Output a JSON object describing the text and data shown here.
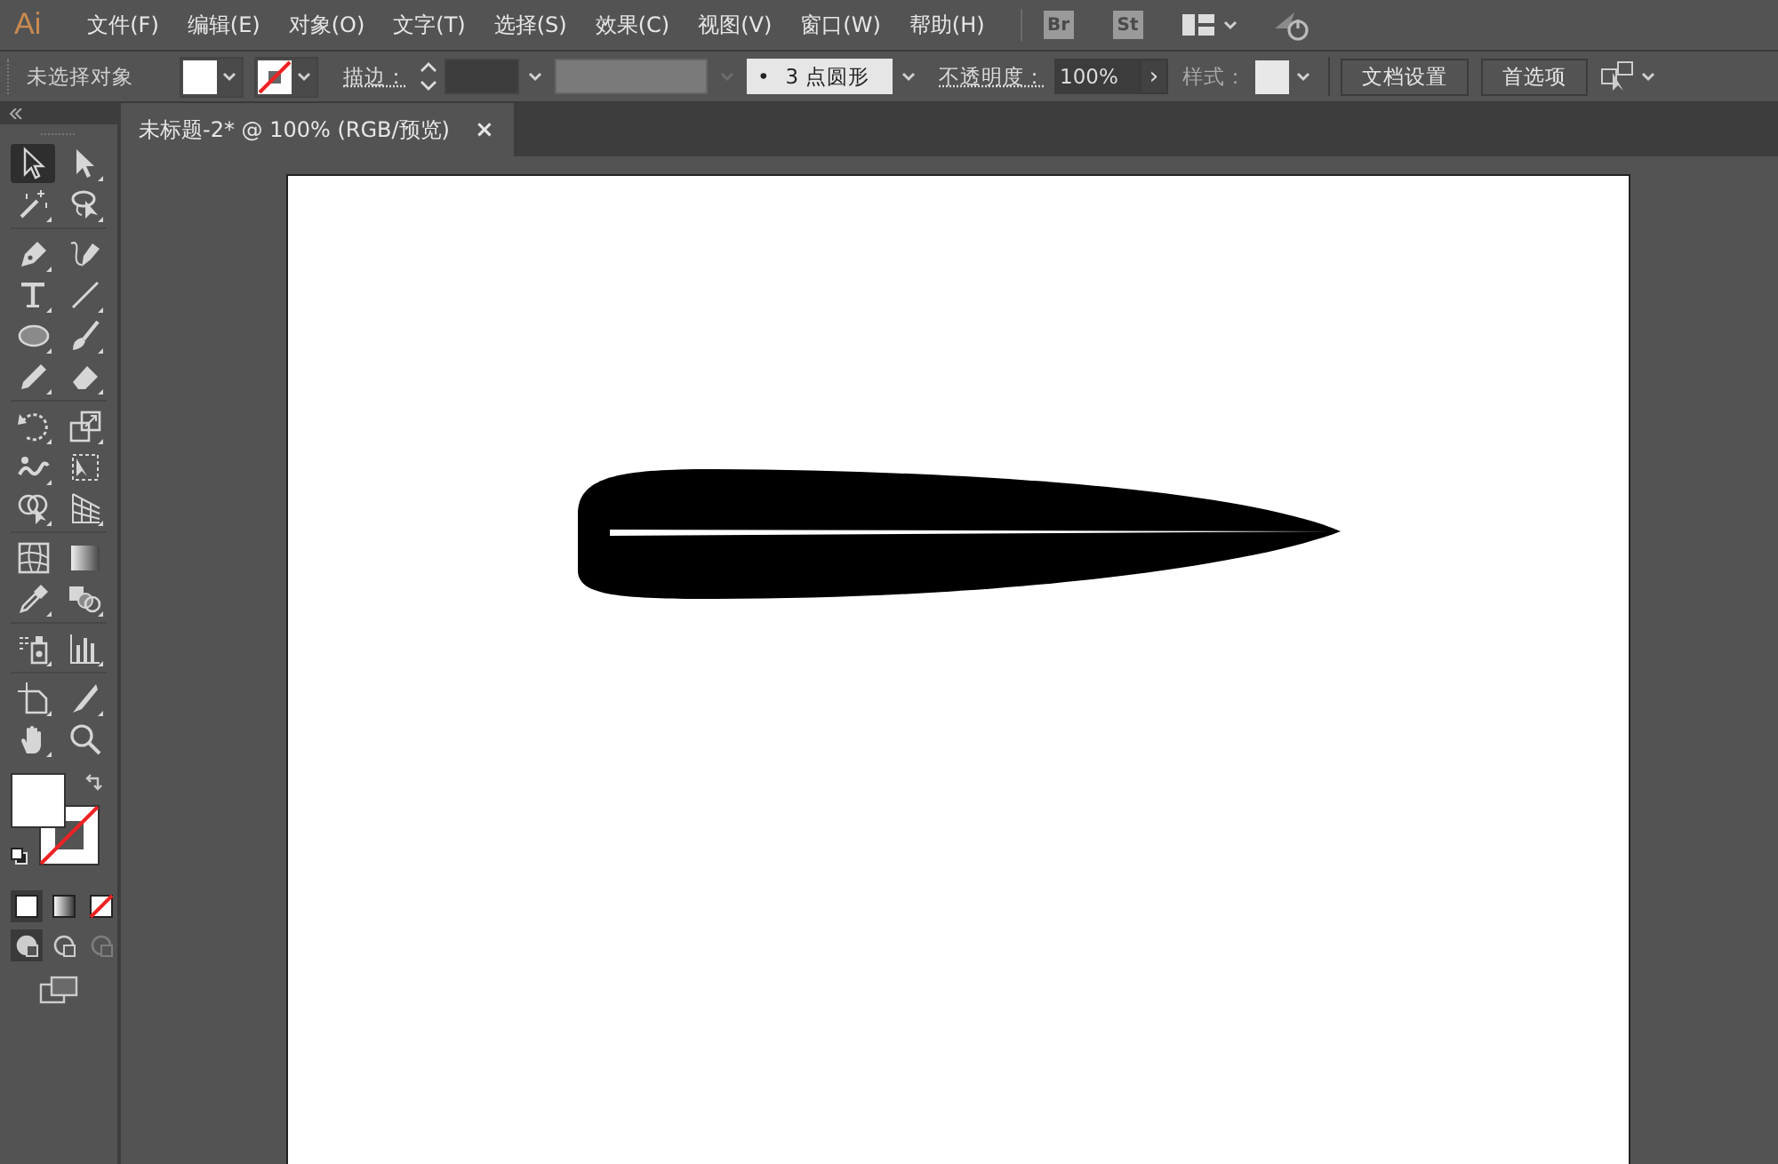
{
  "menu_bar": {
    "logo": "Ai",
    "menus": [
      "文件(F)",
      "编辑(E)",
      "对象(O)",
      "文字(T)",
      "选择(S)",
      "效果(C)",
      "视图(V)",
      "窗口(W)",
      "帮助(H)"
    ],
    "apps": [
      "Br",
      "St"
    ]
  },
  "control_bar": {
    "selection_status": "未选择对象",
    "stroke_label": "描边：",
    "brush_dot": "•",
    "brush_label": "3 点圆形",
    "opacity_label": "不透明度：",
    "opacity_value": "100%",
    "opacity_arrow": "›",
    "style_label": "样式：",
    "buttons": [
      "文档设置",
      "首选项"
    ]
  },
  "document_tab": {
    "title": "未标题-2* @ 100% (RGB/预览)",
    "close": "×",
    "selected": true
  },
  "tools": [
    {
      "selected": true
    },
    {
      "selected": false
    },
    {
      "selected": false
    },
    {
      "selected": false
    },
    {
      "selected": false
    },
    {
      "selected": false
    },
    {
      "selected": false
    },
    {
      "selected": false
    },
    {
      "selected": false
    },
    {
      "selected": false
    },
    {
      "selected": false
    },
    {
      "selected": false
    },
    {
      "selected": false
    },
    {
      "selected": false
    },
    {
      "selected": false
    },
    {
      "selected": false
    },
    {
      "selected": false
    },
    {
      "selected": false
    },
    {
      "selected": false
    },
    {
      "selected": false
    },
    {
      "selected": false
    },
    {
      "selected": false
    },
    {
      "selected": false
    },
    {
      "selected": false
    },
    {
      "selected": false
    },
    {
      "selected": false
    },
    {
      "selected": false
    },
    {
      "selected": false
    }
  ],
  "color_modes": [
    {
      "kind": "color",
      "selected": true
    },
    {
      "kind": "gradient",
      "selected": false
    },
    {
      "kind": "none",
      "selected": false
    }
  ],
  "draw_modes": [
    {
      "selected": true,
      "disabled": false
    },
    {
      "selected": false,
      "disabled": false
    },
    {
      "selected": false,
      "disabled": true
    }
  ]
}
